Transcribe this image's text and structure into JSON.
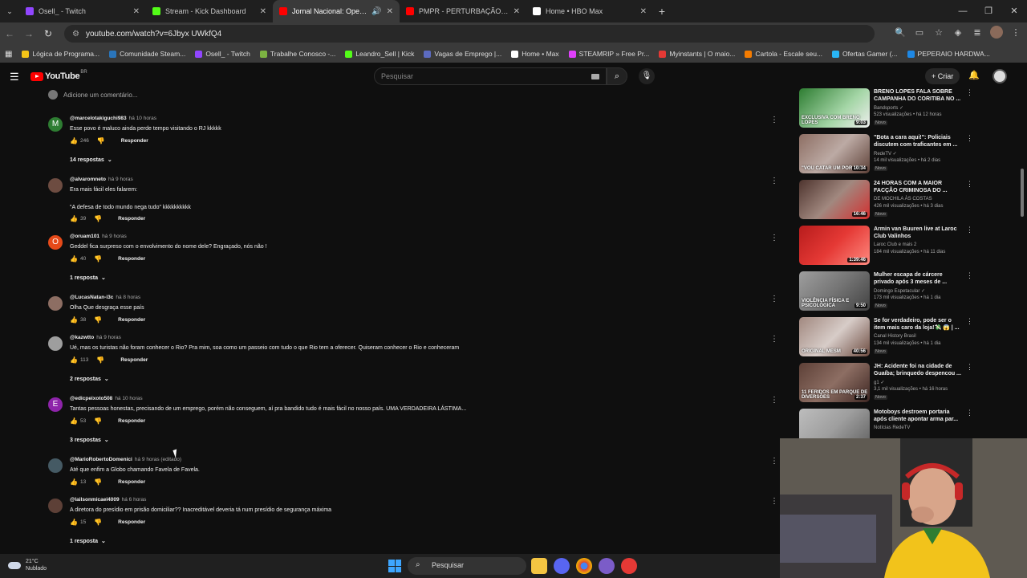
{
  "tabs": [
    {
      "title": "Osell_ - Twitch",
      "color": "#9146ff"
    },
    {
      "title": "Stream - Kick Dashboard",
      "color": "#53fc18"
    },
    {
      "title": "Jornal Nacional: Operação",
      "color": "#ff0000",
      "active": true
    },
    {
      "title": "PMPR - PERTURBAÇÃO DO SO",
      "color": "#ff0000"
    },
    {
      "title": "Home • HBO Max",
      "color": "#ffffff"
    }
  ],
  "new_tab": "+",
  "url": "youtube.com/watch?v=6Jbyx UWkfQ4",
  "bookmarks": [
    {
      "label": "Lógica de Programa...",
      "color": "#f5c518"
    },
    {
      "label": "Comunidade Steam...",
      "color": "#2a75bb"
    },
    {
      "label": "Osell_ - Twitch",
      "color": "#9146ff"
    },
    {
      "label": "Trabalhe Conosco -...",
      "color": "#7cb342"
    },
    {
      "label": "Leandro_Sell | Kick",
      "color": "#53fc18"
    },
    {
      "label": "Vagas de Emprego |...",
      "color": "#5c6bc0"
    },
    {
      "label": "Home • Max",
      "color": "#ffffff"
    },
    {
      "label": "STEAMRIP » Free Pr...",
      "color": "#e040fb"
    },
    {
      "label": "Myinstants | O maio...",
      "color": "#e53935"
    },
    {
      "label": "Cartola - Escale seu...",
      "color": "#f57c00"
    },
    {
      "label": "Ofertas Gamer (...",
      "color": "#29b6f6"
    },
    {
      "label": "PEPERAIO HARDWA...",
      "color": "#1e88e5"
    }
  ],
  "youtube": {
    "logo": "YouTube",
    "country": "BR",
    "search_placeholder": "Pesquisar",
    "create_label": "+ Criar"
  },
  "add_comment": "Adicione um comentário...",
  "comments": [
    {
      "handle": "@marcelotakiguchi983",
      "time": "há 10 horas",
      "text": "Esse povo é maluco ainda perde tempo visitando o RJ kkkkk",
      "likes": "246",
      "avatar_letter": "M",
      "avatar_color": "#2e7d32",
      "replies": "14 respostas"
    },
    {
      "handle": "@alvaromneto",
      "time": "há 9 horas",
      "text": "Era mais fácil eles falarem:\n\n\"A defesa de todo mundo nega tudo\" kkkkkkkkkk",
      "likes": "39",
      "avatar_letter": "",
      "avatar_color": "#6d4c41",
      "replies": ""
    },
    {
      "handle": "@oruam101",
      "time": "há 9 horas",
      "text": "Geddel fica surpreso com o envolvimento do nome dele? Engraçado, nós não !",
      "likes": "40",
      "avatar_letter": "O",
      "avatar_color": "#e64a19",
      "replies": "1 resposta"
    },
    {
      "handle": "@LucasNatan-i3c",
      "time": "há 8 horas",
      "text": "Olha Que desgraça esse país",
      "likes": "38",
      "avatar_letter": "",
      "avatar_color": "#8d6e63",
      "replies": ""
    },
    {
      "handle": "@kazwtto",
      "time": "há 9 horas",
      "text": "Ué, mas os turistas não foram conhecer o Rio? Pra mim, soa como um passeio com tudo o que Rio tem a oferecer. Quiseram conhecer o Rio e conheceram",
      "likes": "113",
      "avatar_letter": "",
      "avatar_color": "#9e9e9e",
      "replies": "2 respostas"
    },
    {
      "handle": "@edicpeixoto508",
      "time": "há 10 horas",
      "text": "Tantas pessoas honestas, precisando de um emprego, porém não conseguem, aí pra bandido tudo é mais fácil no nosso país. UMA VERDADEIRA LÁSTIMA...",
      "likes": "53",
      "avatar_letter": "E",
      "avatar_color": "#8e24aa",
      "replies": "3 respostas"
    },
    {
      "handle": "@MarioRobertoDomenici",
      "time": "há 9 horas (editado)",
      "text": "Até que enfim a Globo  chamando Favela de Favela.",
      "likes": "13",
      "avatar_letter": "",
      "avatar_color": "#455a64",
      "replies": ""
    },
    {
      "handle": "@lailsonmicael4009",
      "time": "há 6 horas",
      "text": "A diretora do presídio em prisão domiciliar?? Inacreditável deveria tá num presídio de segurança máxima",
      "likes": "15",
      "avatar_letter": "",
      "avatar_color": "#5d4037",
      "replies": "1 resposta"
    }
  ],
  "reply_label": "Responder",
  "videos": [
    {
      "title": "BRENO LOPES FALA SOBRE CAMPANHA DO CORITIBA NO ...",
      "channel": "Bandsports ✓",
      "stats": "523 visualizações • há 12 horas",
      "new": "Novo",
      "duration": "9:03",
      "caption": "EXCLUSIVA COM BRENO LOPES",
      "thumb": "#1b5e20"
    },
    {
      "title": "\"Bota a cara aqui!\": Policiais discutem com traficantes em ...",
      "channel": "RedeTV ✓",
      "stats": "14 mil visualizações • há 2 dias",
      "new": "Novo",
      "duration": "10:34",
      "caption": "\"VOU CATAR UM POR UM\"",
      "thumb": "#795548"
    },
    {
      "title": "24 HORAS COM A MAIOR FACÇÃO CRIMINOSA DO ...",
      "channel": "DE MOCHILA ÀS COSTAS",
      "stats": "426 mil visualizações • há 3 dias",
      "new": "Novo",
      "duration": "16:46",
      "caption": "",
      "thumb": "#6d4c41"
    },
    {
      "title": "Armin van Buuren live at Laroc Club Valinhos",
      "channel": "Laroc Club e mais 2",
      "stats": "184 mil visualizações • há 11 dias",
      "new": "",
      "duration": "1:39:46",
      "caption": "",
      "thumb": "#c62828"
    },
    {
      "title": "Mulher escapa de cárcere privado após 3 meses de ...",
      "channel": "Domingo Espetacular ✓",
      "stats": "173 mil visualizações • há 1 dia",
      "new": "Novo",
      "duration": "9:50",
      "caption": "VIOLÊNCIA FÍSICA E PSICOLÓGICA",
      "thumb": "#757575"
    },
    {
      "title": "Se for verdadeiro, pode ser o item mais caro da loja!💸 😱 | ...",
      "channel": "Canal History Brasil",
      "stats": "134 mil visualizações • há 1 dia",
      "new": "Novo",
      "duration": "40:56",
      "caption": "ORIGINAL MESM",
      "thumb": "#8d6e63"
    },
    {
      "title": "JH: Acidente foi na cidade de Guaíba; brinquedo despencou ...",
      "channel": "g1 ✓",
      "stats": "3,1 mil visualizações • há 16 horas",
      "new": "Novo",
      "duration": "2:37",
      "caption": "11 FERIDOS EM PARQUE DE DIVERSÕES",
      "thumb": "#5d4037"
    },
    {
      "title": "Motoboys destroem portaria após cliente apontar arma par...",
      "channel": "Notícias RedeTV",
      "stats": "",
      "new": "",
      "duration": "",
      "caption": "",
      "thumb": "#9e9e9e"
    }
  ],
  "taskbar": {
    "temp": "21°C",
    "weather": "Nublado",
    "search": "Pesquisar"
  }
}
